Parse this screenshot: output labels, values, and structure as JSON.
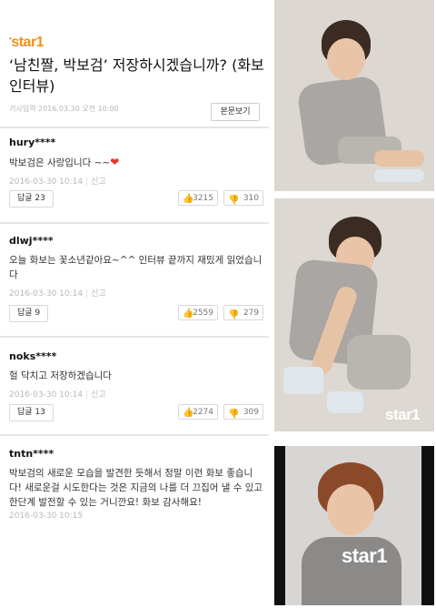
{
  "article": {
    "source_logo": "star1",
    "title": "‘남친짤, 박보검’ 저장하시겠습니까? (화보 인터뷰)",
    "meta": "기사입력 2016.03.30 오전 10:00",
    "view_original_label": "본문보기"
  },
  "comments": [
    {
      "author": "hury****",
      "text": "박보검은 사랑입니다 ~~",
      "emoji": "❤",
      "date": "2016-03-30 10:14",
      "report": "신고",
      "reply_label": "답글 23",
      "likes": "3215",
      "dislikes": "310"
    },
    {
      "author": "dlwj****",
      "text": "오늘 화보는 꽃소년같아요~^^ 인터뷰 끝까지 재밌게 읽었습니다",
      "date": "2016-03-30 10:14",
      "report": "신고",
      "reply_label": "답글 9",
      "likes": "2559",
      "dislikes": "279"
    },
    {
      "author": "noks****",
      "text": "헐 닥치고 저장하겠습니다",
      "date": "2016-03-30 10:14",
      "report": "신고",
      "reply_label": "답글 13",
      "likes": "2274",
      "dislikes": "309"
    },
    {
      "author": "tntn****",
      "text": "박보검의 새로운 모습을 발견한 듯해서 정말 이런 화보 좋습니다! 새로운걸 시도한다는 것은 지금의 나를 더 끄집어 낼 수 있고 한단계 발전할 수 있는 거니깐요! 화보 감사해요!",
      "date": "2016-03-30 10:15"
    }
  ],
  "photos": {
    "watermark": "star1",
    "colors": {
      "sweater": "#a9a6a4",
      "hair": "#3b2b22",
      "accent": "#f09018"
    }
  }
}
